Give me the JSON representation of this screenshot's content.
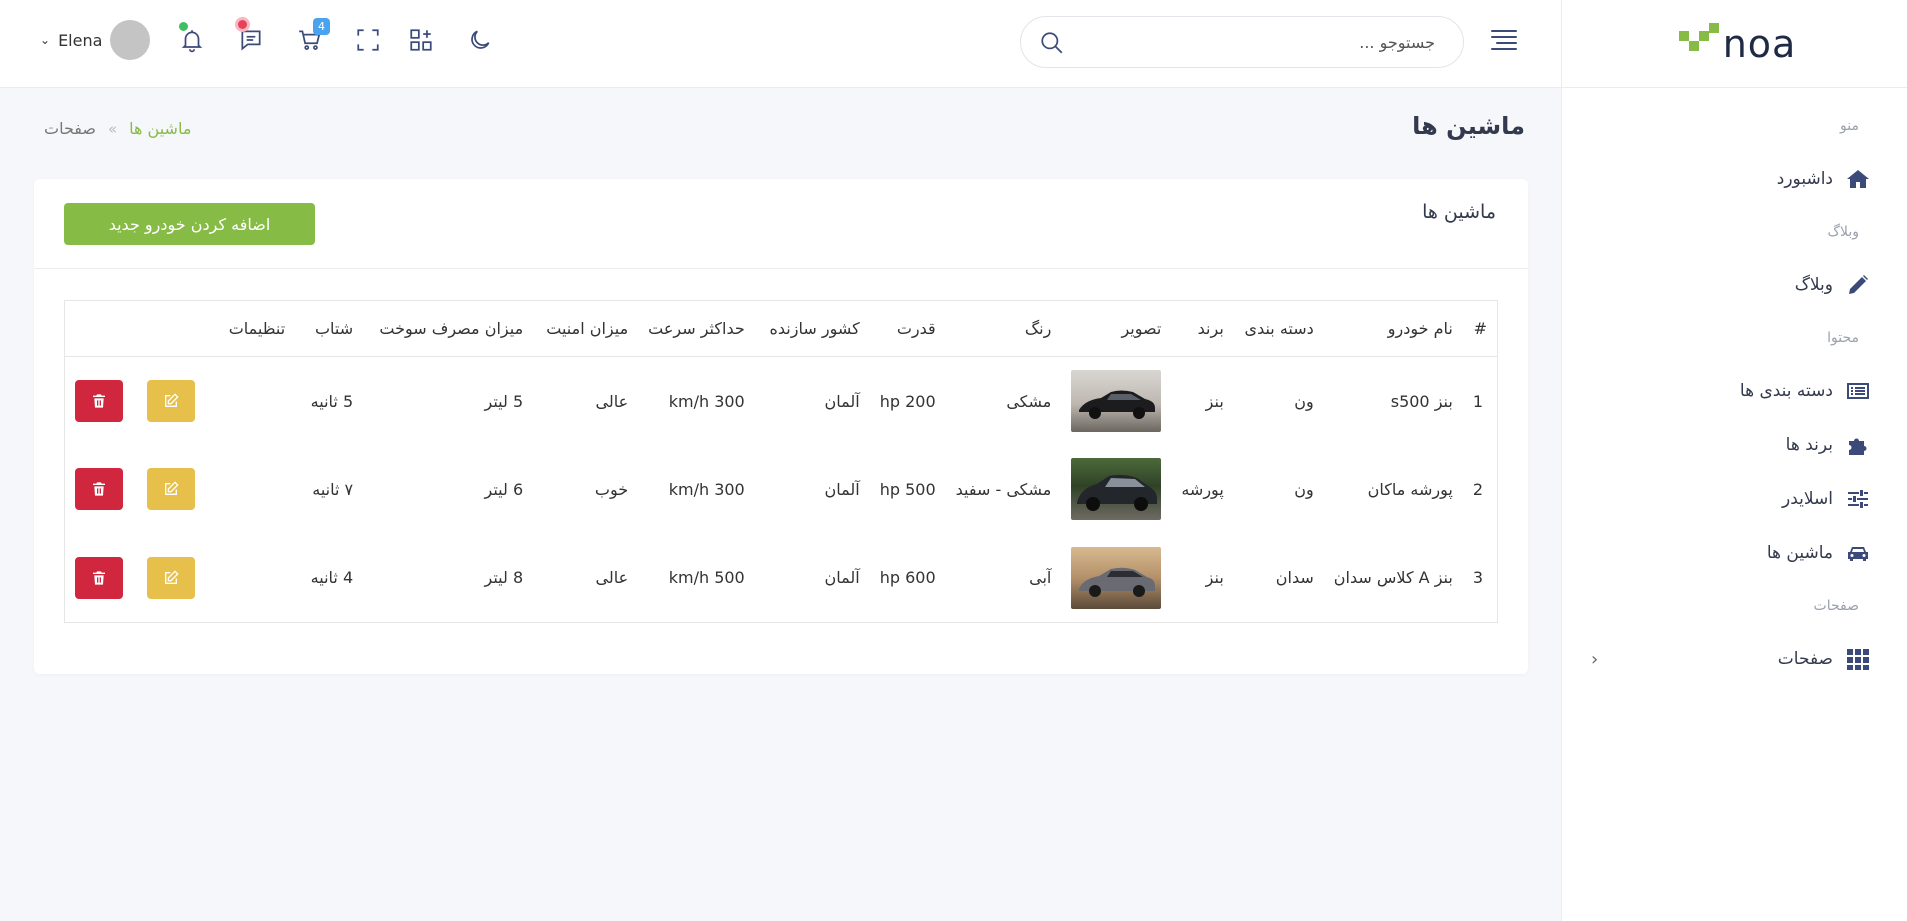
{
  "brand": {
    "logo_text": "noa",
    "accent": "#86bb46"
  },
  "sidebar": {
    "sections": [
      {
        "title": "منو",
        "items": [
          {
            "label": "داشبورد",
            "icon": "home-icon"
          }
        ]
      },
      {
        "title": "وبلاگ",
        "items": [
          {
            "label": "وبلاگ",
            "icon": "pencil-icon"
          }
        ]
      },
      {
        "title": "محتوا",
        "items": [
          {
            "label": "دسته بندی ها",
            "icon": "list-icon"
          },
          {
            "label": "برند ها",
            "icon": "puzzle-icon"
          },
          {
            "label": "اسلایدر",
            "icon": "sliders-icon"
          },
          {
            "label": "ماشین ها",
            "icon": "car-icon"
          }
        ]
      },
      {
        "title": "صفحات",
        "items": [
          {
            "label": "صفحات",
            "icon": "grid-icon",
            "has_submenu": true
          }
        ]
      }
    ]
  },
  "header": {
    "search_placeholder": "جستوجو ...",
    "cart_badge": "4",
    "user_name": "Elena"
  },
  "page": {
    "title": "ماشین ها",
    "breadcrumb": {
      "home": "صفحات",
      "separator": "«",
      "current": "ماشین ها"
    }
  },
  "card": {
    "title": "ماشین ها",
    "add_button": "اضافه کردن خودرو جدید"
  },
  "table": {
    "columns": [
      "#",
      "نام خودرو",
      "دسته بندی",
      "برند",
      "تصویر",
      "رنگ",
      "قدرت",
      "کشور سازنده",
      "حداکثر سرعت",
      "میزان امنیت",
      "میزان مصرف سوخت",
      "شتاب",
      "تنظیمات"
    ],
    "rows": [
      {
        "num": "1",
        "name": "بنز s500",
        "category": "ون",
        "brand": "بنز",
        "color": "مشکی",
        "power": "hp 200",
        "country": "آلمان",
        "max_speed": "km/h 300",
        "safety": "عالی",
        "fuel": "5 لیتر",
        "accel": "5 ثانیه"
      },
      {
        "num": "2",
        "name": "پورشه ماکان",
        "category": "ون",
        "brand": "پورشه",
        "color": "مشکی - سفید",
        "power": "hp 500",
        "country": "آلمان",
        "max_speed": "km/h 300",
        "safety": "خوب",
        "fuel": "6 لیتر",
        "accel": "۷ ثانیه"
      },
      {
        "num": "3",
        "name": "بنز A کلاس سدان",
        "category": "سدان",
        "brand": "بنز",
        "color": "آبی",
        "power": "hp 600",
        "country": "آلمان",
        "max_speed": "km/h 500",
        "safety": "عالی",
        "fuel": "8 لیتر",
        "accel": "4 ثانیه"
      }
    ]
  }
}
